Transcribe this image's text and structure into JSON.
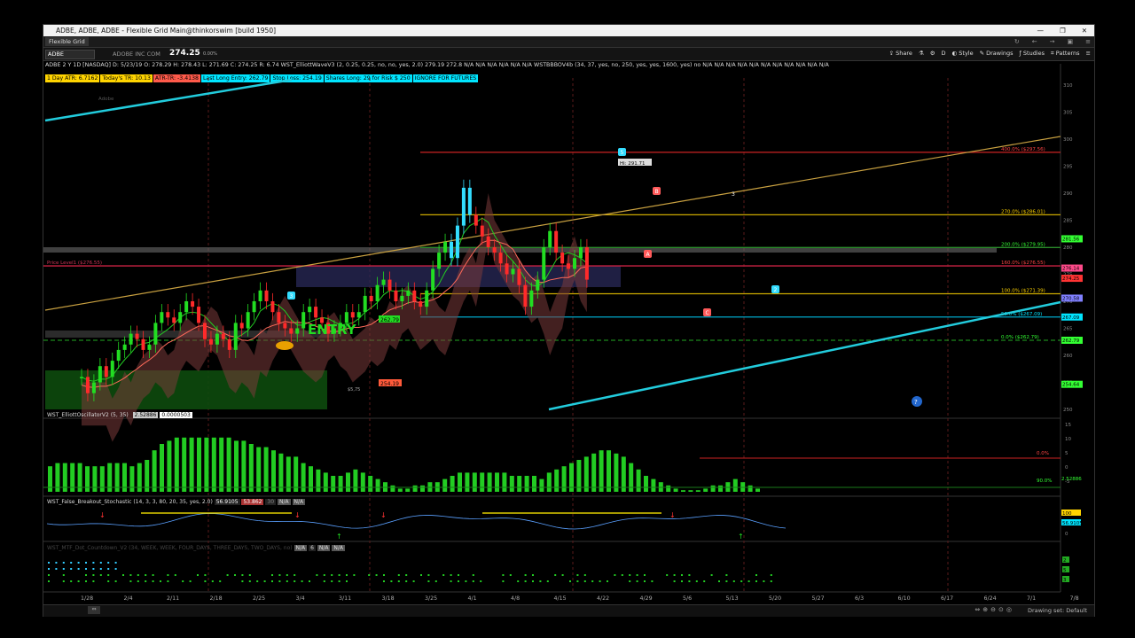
{
  "window": {
    "title": "ADBE, ADBE, ADBE - Flexible Grid Main@thinkorswim [build 1950]",
    "tab": "Flexible Grid",
    "controls": [
      "—",
      "❐",
      "✕"
    ],
    "nav_icons": [
      "↻",
      "←",
      "→",
      "▣",
      "≡"
    ]
  },
  "toolbar": {
    "symbol": "ADBE",
    "company": "ADOBE INC COM",
    "last_price": "274.25",
    "pct": "0.00%",
    "share": "Share",
    "timeframe": "D",
    "style": "Style",
    "drawings": "Drawings",
    "studies": "Studies",
    "patterns": "Patterns"
  },
  "header": {
    "line1": "ADBE 2 Y 1D [NASDAQ]   D: 5/23/19   O: 278.29   H: 278.43   L: 271.69   C: 274.25   R: 6.74   WST_ElliottWaveV3 (2, 0.25, 0.25, no, no, yes, 2.0)  279.19  272.8  N/A  N/A  N/A  N/A  N/A  N/A  WSTBBBOV4b (34, 37, yes, no, 250, yes, yes, 1600, yes)  no  N/A  N/A  N/A  N/A  N/A  N/A  N/A  N/A  N/A  N/A  N/A",
    "chips": [
      {
        "text": "1 Day ATR: 6.7162",
        "color": "#ffd400"
      },
      {
        "text": "Today's TR: 10.13",
        "color": "#ffd400"
      },
      {
        "text": "ATR-TR: -3.4138",
        "color": "#ff5a4a"
      },
      {
        "text": "Last Long Entry: 262.79",
        "color": "#00e5ff"
      },
      {
        "text": "Stop Loss: 254.19",
        "color": "#00e5ff"
      },
      {
        "text": "Shares Long: 29  for Risk $ 250",
        "color": "#00e5ff"
      },
      {
        "text": "IGNORE FOR FUTURES",
        "color": "#00e5ff"
      }
    ],
    "logo": "Adobe"
  },
  "price_panel": {
    "y_axis": [
      "310",
      "305",
      "300",
      "295",
      "290",
      "285",
      "280",
      "275",
      "270",
      "265",
      "260",
      "255",
      "250"
    ],
    "fib_labels": [
      {
        "text": "400.0% ($297.56)",
        "color": "#ff4444"
      },
      {
        "text": "270.0% ($286.01)",
        "color": "#ffd400"
      },
      {
        "text": "200.0% ($279.95)",
        "color": "#33ff33"
      },
      {
        "text": "160.0% ($276.55)",
        "color": "#ff4444"
      },
      {
        "text": "100.0% ($271.39)",
        "color": "#ffd400"
      },
      {
        "text": "50.0% ($267.09)",
        "color": "#00e5ff"
      },
      {
        "text": "0.0% ($262.79)",
        "color": "#33ff33"
      }
    ],
    "price_level_label": "Price Level1 ($276.55)",
    "right_tags": [
      {
        "text": "281.56",
        "color": "#33ff33"
      },
      {
        "text": "276.14",
        "color": "#ff4a8a"
      },
      {
        "text": "274.25",
        "color": "#ff3333"
      },
      {
        "text": "270.58",
        "color": "#8080ff"
      },
      {
        "text": "267.09",
        "color": "#00e5ff"
      },
      {
        "text": "262.79",
        "color": "#33ff33"
      },
      {
        "text": "254.64",
        "color": "#33ff33"
      }
    ],
    "entry_text": "ENTRY",
    "entry_tag": "262.79",
    "stop_tag": "254.19",
    "hi_tag": "Hi: 291.71",
    "wave_labels": [
      "5",
      "B",
      "A",
      "C",
      "3",
      "2"
    ],
    "entry_small": "$5,75"
  },
  "oscillator": {
    "label": "WST_ElliottOscillatorV2 (5, 35)",
    "val1": "2.52886",
    "val2": "0.0000503",
    "y_axis": [
      "15",
      "10",
      "5",
      "0",
      "-5"
    ],
    "tags": [
      {
        "text": "0.0%",
        "color": "#ff4444"
      },
      {
        "text": "90.0%",
        "color": "#33ff33"
      },
      {
        "text": "2.52886",
        "color": "#33ff33"
      }
    ]
  },
  "stochastic": {
    "label": "WST_False_Breakout_Stochastic (14, 3, 3, 80, 20, 35, yes, 2.0)",
    "v1": "56.9105",
    "v2": "53.862",
    "v3": "30",
    "na": [
      "N/A",
      "N/A"
    ],
    "y_axis": [
      "100",
      "50",
      "0"
    ],
    "tags": [
      {
        "text": "100",
        "color": "#ffd400"
      },
      {
        "text": "56.9105",
        "color": "#00e5ff"
      }
    ]
  },
  "mtf": {
    "label": "WST_MTF_Dot_Countdown_V2 (34, WEEK, WEEK, FOUR_DAYS, THREE_DAYS, TWO_DAYS, no)",
    "values": [
      "N/A",
      "6",
      "N/A",
      "N/A"
    ],
    "y_axis": [
      "2",
      "5",
      "3"
    ]
  },
  "x_axis": [
    "1/28",
    "2/4",
    "2/11",
    "2/18",
    "2/25",
    "3/4",
    "3/11",
    "3/18",
    "3/25",
    "4/1",
    "4/8",
    "4/15",
    "4/22",
    "4/29",
    "5/6",
    "5/13",
    "5/20",
    "5/27",
    "6/3",
    "6/10",
    "6/17",
    "6/24",
    "7/1",
    "7/8"
  ],
  "bottom": {
    "drawing_set": "Drawing set: Default"
  }
}
